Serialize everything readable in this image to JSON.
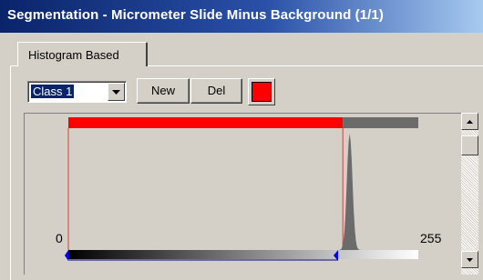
{
  "window": {
    "title": "Segmentation - Micrometer Slide Minus Background (1/1)"
  },
  "tabs": [
    {
      "label": "Histogram Based",
      "active": true
    }
  ],
  "controls": {
    "class_select": {
      "value": "Class 1"
    },
    "new_label": "New",
    "del_label": "Del",
    "class_color": "#ff0000"
  },
  "histogram": {
    "axis_min_label": "0",
    "axis_max_label": "255",
    "range_min": 0,
    "range_max": 255,
    "threshold_low": 0,
    "threshold_high": 200,
    "selection_color": "#ff0000",
    "unselected_color": "#6b6b6b",
    "threshold_line_color": "#d04040",
    "peak_center": 205,
    "peak_width": 3
  },
  "icons": [
    "chevron-down-icon",
    "scroll-up-icon",
    "scroll-down-icon",
    "threshold-marker-icon"
  ]
}
